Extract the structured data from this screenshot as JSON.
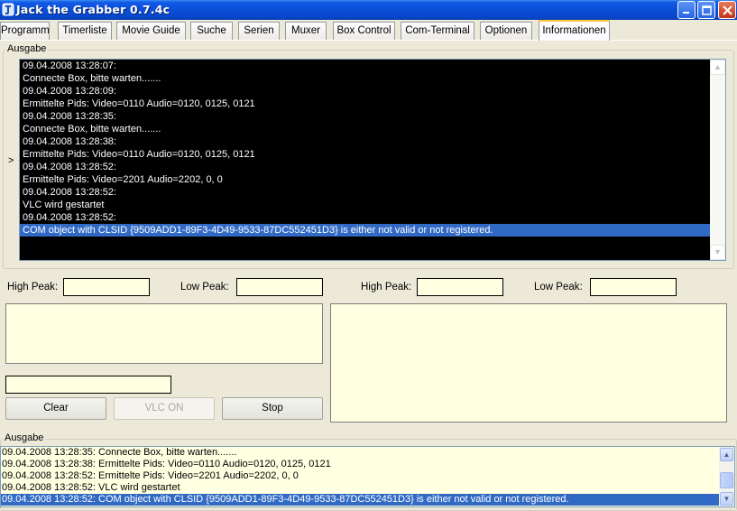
{
  "window": {
    "title": "Jack the Grabber 0.7.4c"
  },
  "tabs": [
    {
      "label": "Programm",
      "active": false
    },
    {
      "label": "Timerliste",
      "active": false
    },
    {
      "label": "Movie Guide",
      "active": false
    },
    {
      "label": "Suche",
      "active": false
    },
    {
      "label": "Serien",
      "active": false
    },
    {
      "label": "Muxer",
      "active": false
    },
    {
      "label": "Box Control",
      "active": false
    },
    {
      "label": "Com-Terminal",
      "active": false
    },
    {
      "label": "Optionen",
      "active": false
    },
    {
      "label": "Informationen",
      "active": true
    }
  ],
  "output_group": {
    "label": "Ausgabe",
    "gutter_marker": ">",
    "lines": [
      "09.04.2008 13:28:07:",
      "Connecte Box, bitte warten.......",
      "09.04.2008 13:28:09:",
      "Ermittelte Pids: Video=0110 Audio=0120, 0125, 0121",
      "09.04.2008 13:28:35:",
      "Connecte Box, bitte warten.......",
      "09.04.2008 13:28:38:",
      "Ermittelte Pids: Video=0110 Audio=0120, 0125, 0121",
      "09.04.2008 13:28:52:",
      "Ermittelte Pids: Video=2201 Audio=2202, 0, 0",
      "09.04.2008 13:28:52:",
      "VLC wird gestartet",
      "09.04.2008 13:28:52:",
      "COM object with CLSID {9509ADD1-89F3-4D49-9533-87DC552451D3} is either not valid or not registered."
    ],
    "selected_line": "COM object with CLSID {9509ADD1-89F3-4D49-9533-87DC552451D3} is either not valid or not registered."
  },
  "peaks": {
    "left_high_label": "High Peak:",
    "left_low_label": "Low Peak:",
    "right_high_label": "High Peak:",
    "right_low_label": "Low Peak:",
    "left_high_value": "",
    "left_low_value": "",
    "right_high_value": "",
    "right_low_value": ""
  },
  "buttons": {
    "clear": "Clear",
    "vlc_on": "VLC ON",
    "stop": "Stop"
  },
  "log_group": {
    "label": "Ausgabe",
    "lines": [
      "09.04.2008 13:28:35: Connecte Box, bitte warten.......",
      "09.04.2008 13:28:38: Ermittelte Pids: Video=0110 Audio=0120, 0125, 0121",
      "09.04.2008 13:28:52: Ermittelte Pids: Video=2201 Audio=2202, 0, 0",
      "09.04.2008 13:28:52: VLC wird gestartet"
    ],
    "selected_line": "09.04.2008 13:28:52: COM object with CLSID {9509ADD1-89F3-4D49-9533-87DC552451D3} is either not valid or not registered."
  },
  "colors": {
    "titlebar": "#0a4fd8",
    "console_bg": "#000000",
    "selection": "#316ac5",
    "field_bg": "#ffffe1",
    "active_tab_accent": "#ffc83c"
  },
  "icons": {
    "app": "jack-app-icon",
    "minimize": "minimize-icon",
    "maximize": "maximize-icon",
    "close": "close-icon",
    "scroll_up": "arrow-up-icon",
    "scroll_down": "arrow-down-icon"
  }
}
